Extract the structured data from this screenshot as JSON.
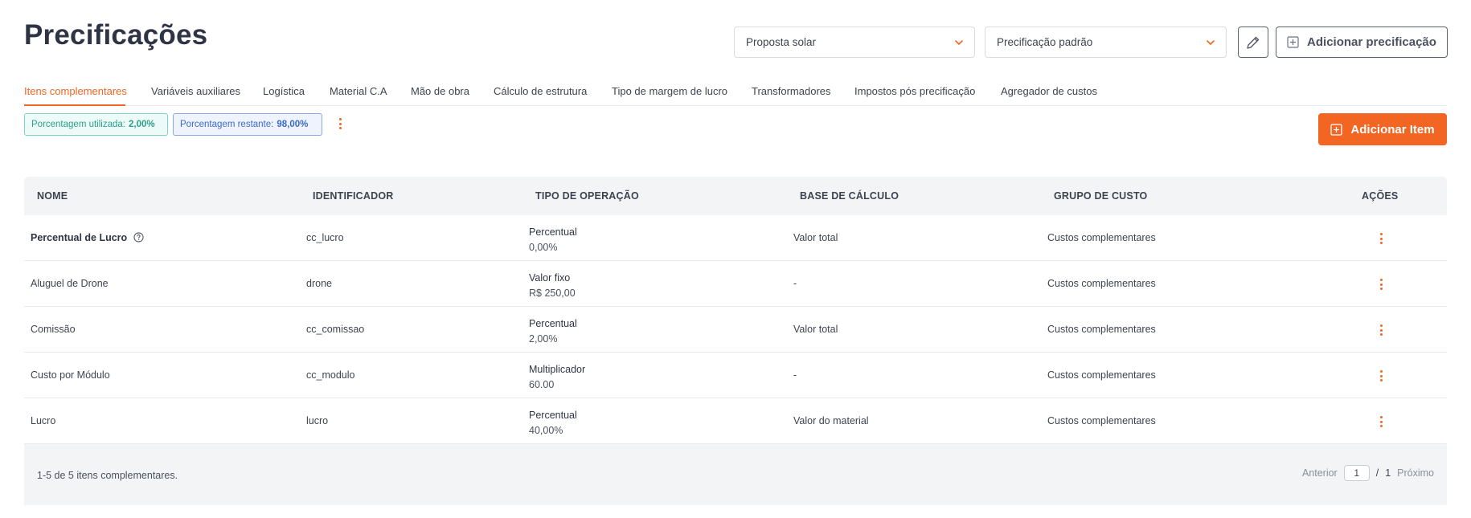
{
  "header": {
    "title": "Precificações",
    "proposal_select": "Proposta solar",
    "pricing_select": "Precificação padrão",
    "add_pricing_label": "Adicionar precificação"
  },
  "tabs": [
    {
      "label": "Itens complementares",
      "active": true
    },
    {
      "label": "Variáveis auxiliares"
    },
    {
      "label": "Logística"
    },
    {
      "label": "Material C.A"
    },
    {
      "label": "Mão de obra"
    },
    {
      "label": "Cálculo de estrutura"
    },
    {
      "label": "Tipo de margem de lucro"
    },
    {
      "label": "Transformadores"
    },
    {
      "label": "Impostos pós precificação"
    },
    {
      "label": "Agregador de custos"
    }
  ],
  "badges": {
    "used_label": "Porcentagem utilizada:",
    "used_value": "2,00%",
    "remaining_label": "Porcentagem restante:",
    "remaining_value": "98,00%"
  },
  "add_item_label": "Adicionar Item",
  "table": {
    "headers": {
      "name": "NOME",
      "identifier": "IDENTIFICADOR",
      "operation": "TIPO DE OPERAÇÃO",
      "base": "BASE DE CÁLCULO",
      "group": "GRUPO DE CUSTO",
      "actions": "AÇÕES"
    },
    "rows": [
      {
        "name": "Percentual de Lucro",
        "id": "cc_lucro",
        "op_type": "Percentual",
        "op_value": "0,00%",
        "base": "Valor total",
        "group": "Custos complementares"
      },
      {
        "name": "Aluguel de Drone",
        "id": "drone",
        "op_type": "Valor fixo",
        "op_value": "R$ 250,00",
        "base": "-",
        "group": "Custos complementares"
      },
      {
        "name": "Comissão",
        "id": "cc_comissao",
        "op_type": "Percentual",
        "op_value": "2,00%",
        "base": "Valor total",
        "group": "Custos complementares"
      },
      {
        "name": "Custo por Módulo",
        "id": "cc_modulo",
        "op_type": "Multiplicador",
        "op_value": "60.00",
        "base": "-",
        "group": "Custos complementares"
      },
      {
        "name": "Lucro",
        "id": "lucro",
        "op_type": "Percentual",
        "op_value": "40,00%",
        "base": "Valor do material",
        "group": "Custos complementares"
      }
    ]
  },
  "footer": {
    "count_text": "1-5 de 5 itens complementares.",
    "prev_label": "Anterior",
    "page_value": "1",
    "separator": "/",
    "total_pages": "1",
    "next_label": "Próximo"
  },
  "colors": {
    "accent": "#f26522",
    "text_dark": "#2f3445",
    "used_badge_text": "#2f9e8c",
    "remaining_badge_text": "#3d6bc9"
  }
}
